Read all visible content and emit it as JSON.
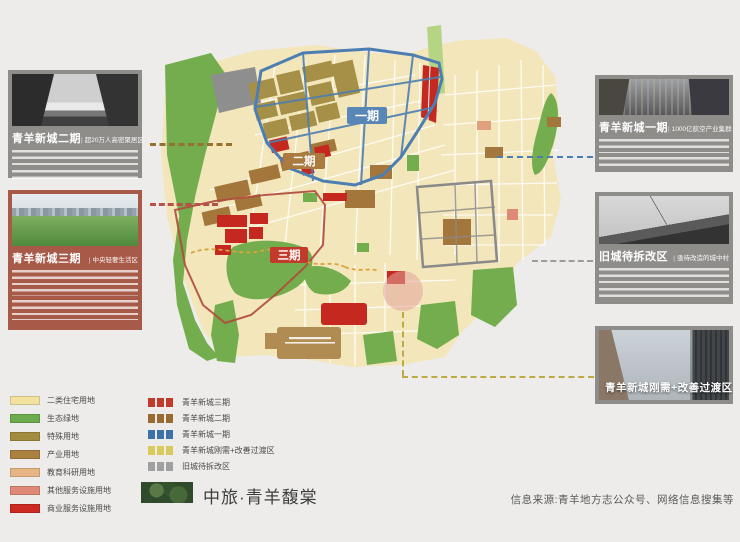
{
  "panels": {
    "left": [
      {
        "title": "青羊新城二期",
        "divider": "|",
        "subtitle": "超20万人高密聚居区"
      },
      {
        "title": "青羊新城三期",
        "divider": "|",
        "subtitle": "中央轻奢生活区"
      }
    ],
    "right": [
      {
        "title": "青羊新城一期",
        "divider": "|",
        "subtitle": "1000亿航空产业集群"
      },
      {
        "title": "旧城待拆改区",
        "divider": "|",
        "subtitle": "亟待改造的城中村"
      },
      {
        "caption": "青羊新城刚需+改善过渡区"
      }
    ]
  },
  "map": {
    "badges": {
      "phase1": "一期",
      "phase2": "二期",
      "phase3": "三期"
    }
  },
  "legend": {
    "landuse": [
      {
        "label": "二类住宅用地",
        "color": "#f2e2a0"
      },
      {
        "label": "生态绿地",
        "color": "#6cac4c"
      },
      {
        "label": "特殊用地",
        "color": "#a28d3f"
      },
      {
        "label": "产业用地",
        "color": "#ab813f"
      },
      {
        "label": "教育科研用地",
        "color": "#e7b584"
      },
      {
        "label": "其他服务设施用地",
        "color": "#df8a76"
      },
      {
        "label": "商业服务设施用地",
        "color": "#cc2a22"
      }
    ],
    "districts": [
      {
        "label": "青羊新城三期",
        "color": "#c23b2a"
      },
      {
        "label": "青羊新城二期",
        "color": "#9a6a33"
      },
      {
        "label": "青羊新城一期",
        "color": "#3c72a8"
      },
      {
        "label": "青羊新城刚需+改善过渡区",
        "color": "#d9ca5c"
      },
      {
        "label": "旧城待拆改区",
        "color": "#a0a0a0"
      }
    ]
  },
  "footer": {
    "logo": "中旅·青羊馥棠",
    "source": "信息来源:青羊地方志公众号、网络信息搜集等"
  }
}
